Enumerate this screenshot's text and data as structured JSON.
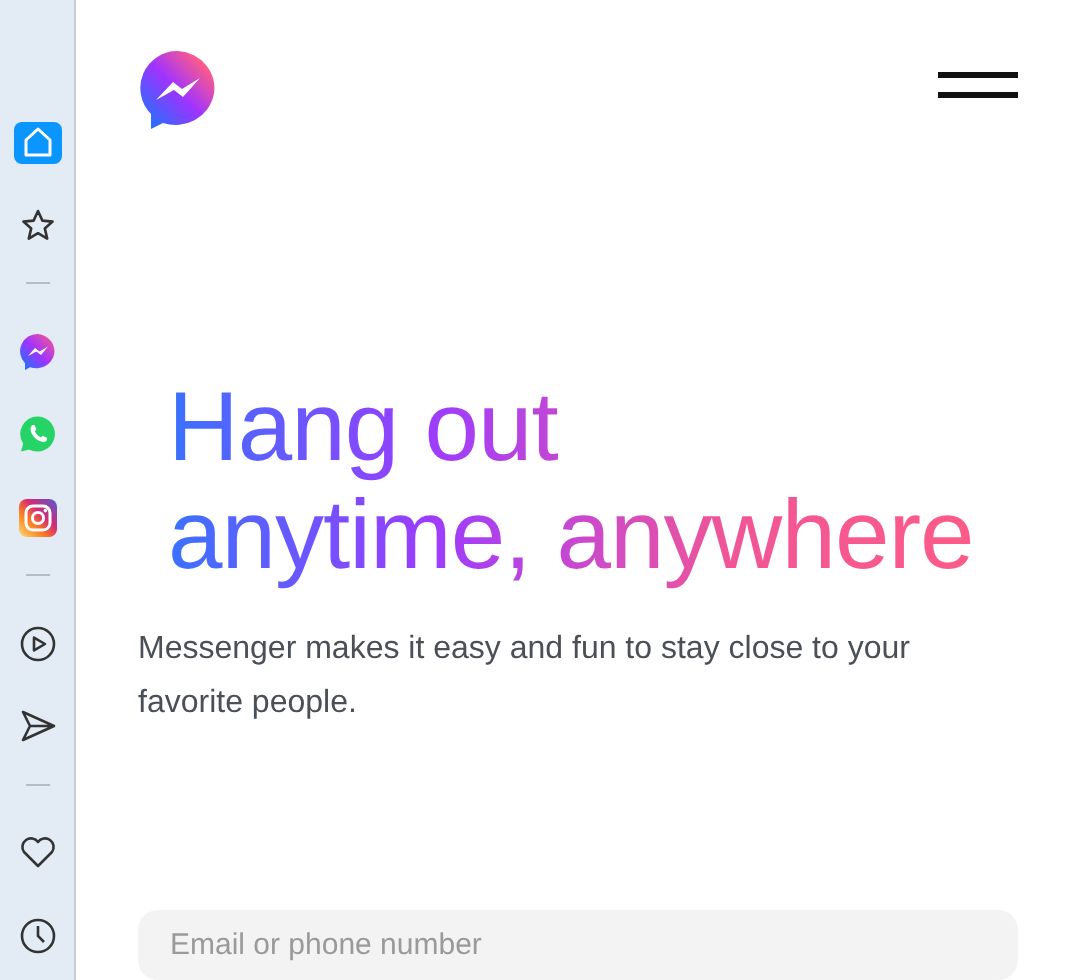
{
  "sidebar": {
    "items": [
      {
        "kind": "button",
        "selected": true
      },
      {
        "kind": "button",
        "selected": false
      },
      {
        "kind": "separator"
      },
      {
        "kind": "button",
        "selected": false
      },
      {
        "kind": "button",
        "selected": false
      },
      {
        "kind": "button",
        "selected": false
      },
      {
        "kind": "separator"
      },
      {
        "kind": "button",
        "selected": false
      },
      {
        "kind": "button",
        "selected": false
      },
      {
        "kind": "separator"
      },
      {
        "kind": "button",
        "selected": false
      },
      {
        "kind": "button",
        "selected": false
      }
    ]
  },
  "headline": [
    "Hang out",
    "anytime, anywhere"
  ],
  "description": "Messenger makes it easy and fun to stay close to your favorite people.",
  "login": {
    "email": {
      "placeholder": "Email or phone number"
    }
  }
}
